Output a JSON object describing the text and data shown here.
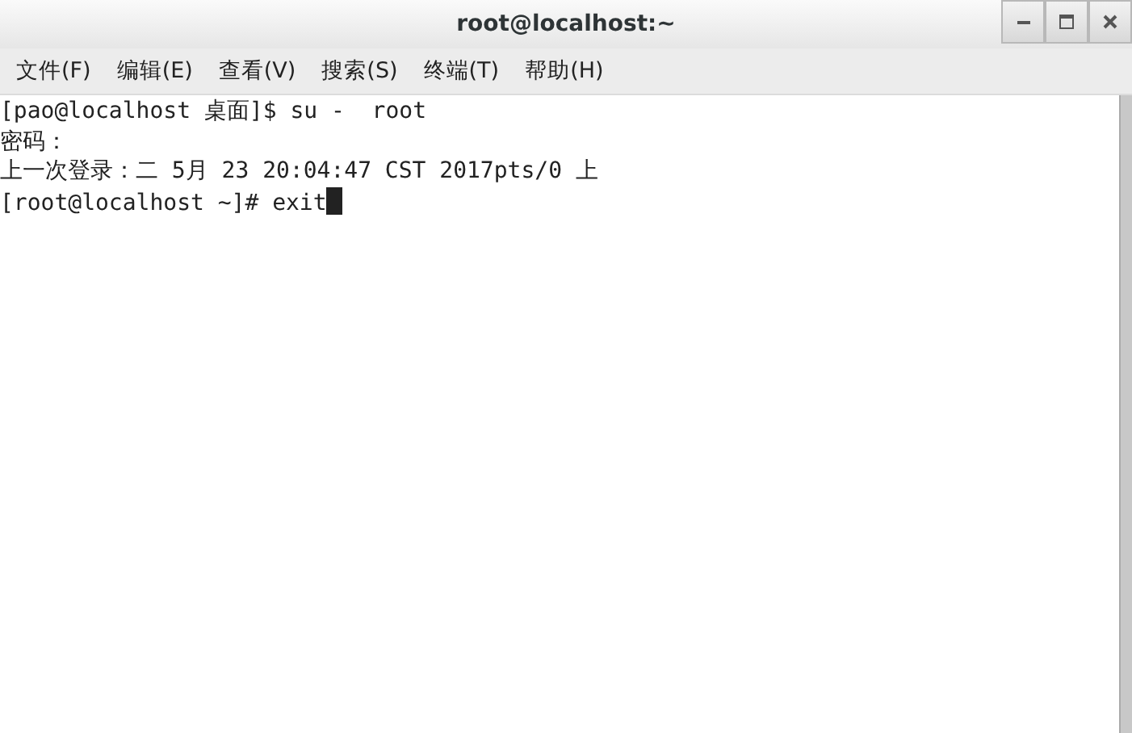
{
  "window": {
    "title": "root@localhost:~"
  },
  "menu": [
    "文件(F)",
    "编辑(E)",
    "查看(V)",
    "搜索(S)",
    "终端(T)",
    "帮助(H)"
  ],
  "terminal": {
    "lines": [
      "[pao@localhost 桌面]$ su -  root",
      "密码：",
      "上一次登录：二 5月 23 20:04:47 CST 2017pts/0 上",
      "[root@localhost ~]# exit"
    ],
    "cursor": true
  }
}
